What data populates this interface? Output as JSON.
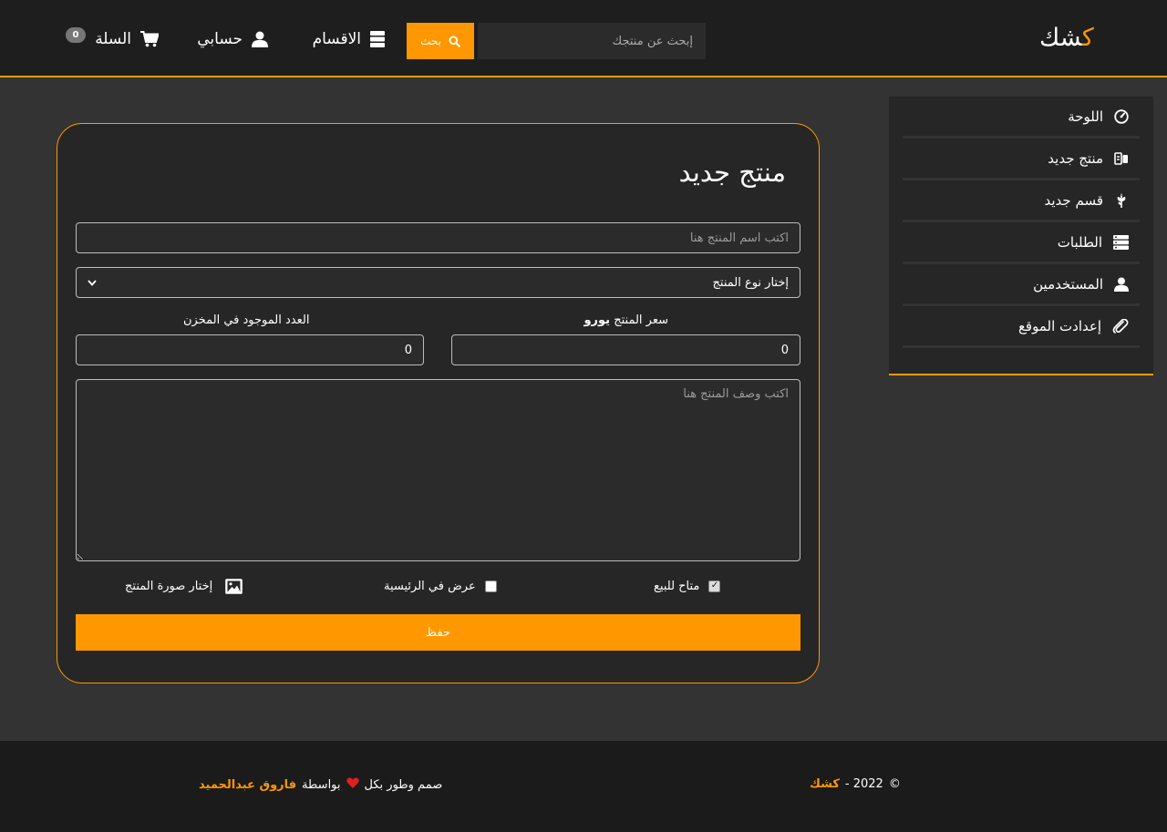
{
  "header": {
    "logo": "كشك",
    "search_placeholder": "إبحث عن منتجك",
    "search_button": "بحث",
    "nav_categories": "الاقسام",
    "nav_account": "حسابي",
    "nav_cart": "السلة",
    "cart_count": "0"
  },
  "sidebar": {
    "items": [
      {
        "label": "اللوحة",
        "icon": "gauge-icon"
      },
      {
        "label": "منتج جديد",
        "icon": "product-icon"
      },
      {
        "label": "قسم جديد",
        "icon": "leaf-icon"
      },
      {
        "label": "الطلبات",
        "icon": "server-icon"
      },
      {
        "label": "المستخدمين",
        "icon": "user-icon"
      },
      {
        "label": "إعدادت الموقع",
        "icon": "paperclip-icon"
      }
    ]
  },
  "form": {
    "title": "منتج جديد",
    "name_placeholder": "اكتب اسم المنتج هنا",
    "type_select_value": "إختار نوع المنتج",
    "price_label": "سعر المنتج",
    "price_currency": "يورو",
    "stock_label": "العدد الموجود في المخزن",
    "price_value": "0",
    "stock_value": "0",
    "description_placeholder": "اكتب وصف المنتج هنا",
    "available_label": "متاح للبيع",
    "available_checked": true,
    "homepage_label": "عرض في الرئيسية",
    "homepage_checked": false,
    "image_label": "إختار صورة المنتج",
    "save_button": "حفظ"
  },
  "footer": {
    "credit_prefix": "صمم وطور بكل",
    "credit_by": "بواسطة",
    "credit_name": "فاروق عبدالحميد",
    "copyright_symbol": "©",
    "copyright_year": "2022 -",
    "copyright_brand": "كشك"
  },
  "colors": {
    "accent": "#ff9800",
    "header_bg": "#1e1e1e",
    "page_bg": "#333333",
    "panel_bg": "#262626"
  }
}
